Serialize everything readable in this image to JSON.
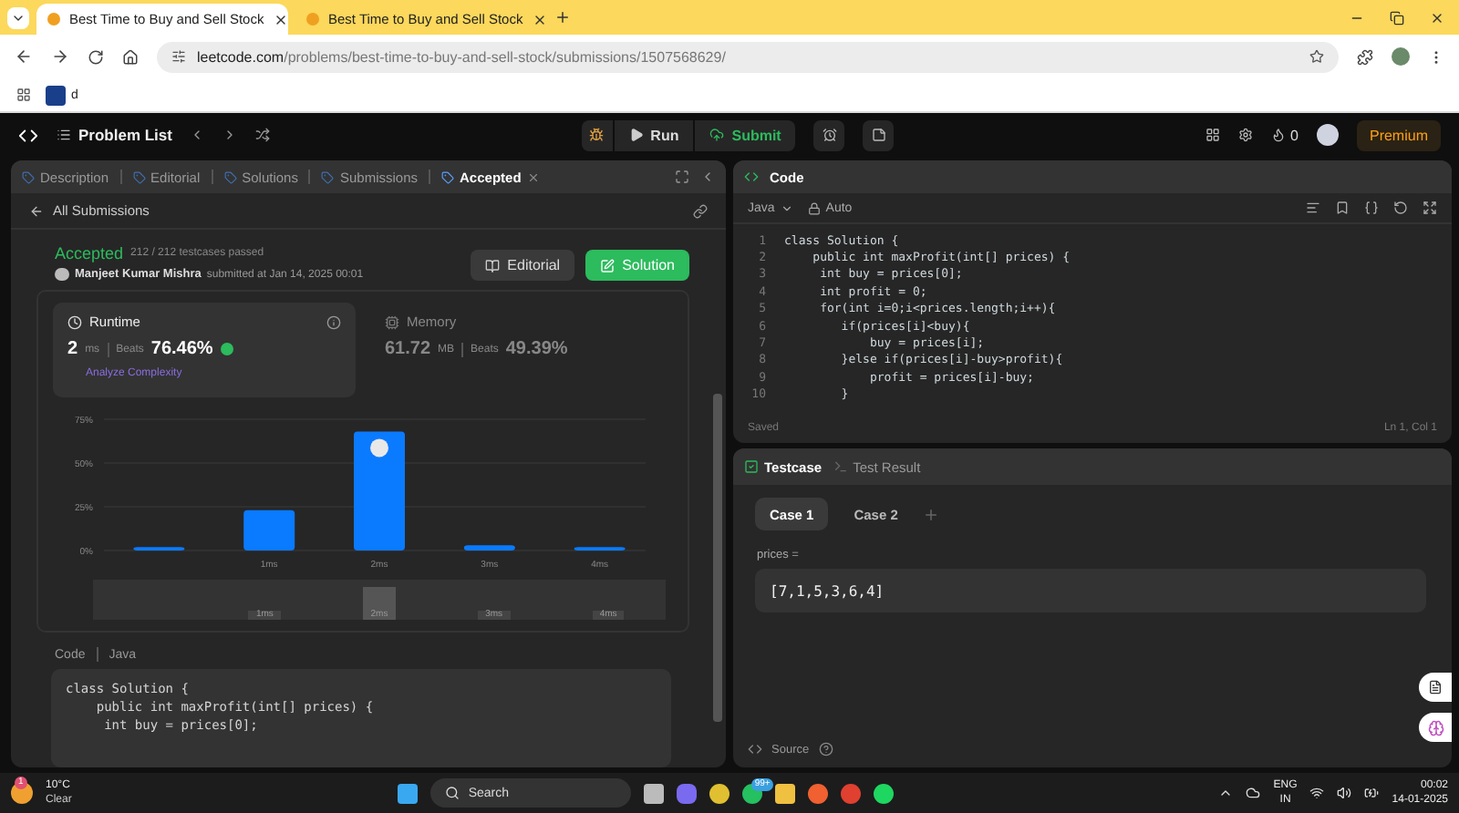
{
  "browser": {
    "tabs": [
      {
        "title": "Best Time to Buy and Sell Stock",
        "selected": true
      },
      {
        "title": "Best Time to Buy and Sell Stock",
        "selected": false
      }
    ],
    "url_domain": "leetcode.com",
    "url_path": "/problems/best-time-to-buy-and-sell-stock/submissions/1507568629/",
    "bookmark": "d"
  },
  "navbar": {
    "title": "Problem List",
    "run": "Run",
    "submit": "Submit",
    "streak": "0",
    "premium": "Premium"
  },
  "left_panel": {
    "tabs": [
      {
        "label": "Description",
        "selected": false,
        "closable": false
      },
      {
        "label": "Editorial",
        "selected": false,
        "closable": false
      },
      {
        "label": "Solutions",
        "selected": false,
        "closable": false
      },
      {
        "label": "Submissions",
        "selected": false,
        "closable": false
      },
      {
        "label": "Accepted",
        "selected": true,
        "closable": true
      }
    ],
    "back": "All Submissions",
    "result": {
      "status": "Accepted",
      "testcases": "212 / 212 testcases passed",
      "author": "Manjeet Kumar Mishra",
      "submitted": "submitted at Jan 14, 2025 00:01"
    },
    "buttons": [
      {
        "label": "Editorial",
        "kind": "secondary"
      },
      {
        "label": "Solution",
        "kind": "primary"
      }
    ],
    "stats": [
      {
        "title": "Runtime",
        "value": "2",
        "unit": "ms",
        "beats_label": "Beats",
        "beats": "76.46%",
        "selected": true,
        "link": "Analyze Complexity"
      },
      {
        "title": "Memory",
        "value": "61.72",
        "unit": "MB",
        "beats_label": "Beats",
        "beats": "49.39%",
        "selected": false
      }
    ],
    "chart_data": {
      "type": "bar",
      "categories": [
        null,
        "1ms",
        "2ms",
        "3ms",
        "4ms"
      ],
      "values": [
        2,
        23,
        68,
        3,
        2
      ],
      "ylim": [
        0,
        75
      ],
      "yticks": [
        {
          "value": 0,
          "label": "0%"
        },
        {
          "value": 25,
          "label": "25%"
        },
        {
          "value": 50,
          "label": "50%"
        },
        {
          "value": 75,
          "label": "75%"
        }
      ]
    },
    "brush_labels": [
      "1ms",
      "2ms",
      "3ms",
      "4ms"
    ],
    "code_section": {
      "label": "Code",
      "language": "Java",
      "lines": [
        "class Solution {",
        "    public int maxProfit(int[] prices) {",
        "     int buy = prices[0];"
      ]
    }
  },
  "editor": {
    "title": "Code",
    "language": "Java",
    "mode": "Auto",
    "lines": [
      {
        "number": "1",
        "text": "class Solution {"
      },
      {
        "number": "2",
        "text": "    public int maxProfit(int[] prices) {"
      },
      {
        "number": "3",
        "text": "     int buy = prices[0];"
      },
      {
        "number": "4",
        "text": "     int profit = 0;"
      },
      {
        "number": "5",
        "text": "     for(int i=0;i<prices.length;i++){"
      },
      {
        "number": "6",
        "text": "        if(prices[i]<buy){"
      },
      {
        "number": "7",
        "text": "            buy = prices[i];"
      },
      {
        "number": "8",
        "text": "        }else if(prices[i]-buy>profit){"
      },
      {
        "number": "9",
        "text": "            profit = prices[i]-buy;"
      },
      {
        "number": "10",
        "text": "        }"
      }
    ],
    "status": "Saved",
    "position": "Ln 1, Col 1"
  },
  "testcase": {
    "tabs": [
      {
        "label": "Testcase",
        "selected": true
      },
      {
        "label": "Test Result",
        "selected": false
      }
    ],
    "cases": [
      {
        "label": "Case 1",
        "selected": true
      },
      {
        "label": "Case 2",
        "selected": false
      }
    ],
    "param": "prices =",
    "value": "[7,1,5,3,6,4]",
    "source": "Source"
  },
  "taskbar": {
    "temperature": "10°C",
    "weather": "Clear",
    "weather_badge": "1",
    "search": "Search",
    "chat_badge": "99+",
    "language": "ENG",
    "region": "IN",
    "time": "00:02",
    "date": "14-01-2025"
  }
}
